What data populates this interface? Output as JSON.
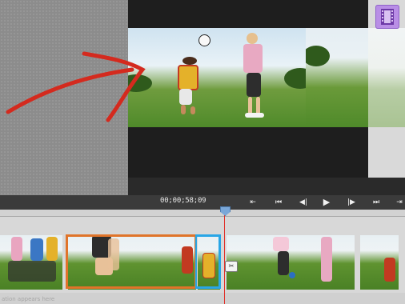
{
  "monitor": {
    "timecode": "00;00;58;09"
  },
  "transport": {
    "buttons": [
      {
        "name": "go-to-in-point",
        "glyph": "⇤"
      },
      {
        "name": "step-back-large",
        "glyph": "⏮"
      },
      {
        "name": "step-back-frame",
        "glyph": "◀|"
      },
      {
        "name": "play",
        "glyph": "▶"
      },
      {
        "name": "step-forward-frame",
        "glyph": "|▶"
      },
      {
        "name": "step-forward-large",
        "glyph": "⏭"
      },
      {
        "name": "go-to-out-point",
        "glyph": "⇥"
      }
    ]
  },
  "timeline": {
    "status_text": "ation appears here"
  },
  "colors": {
    "selection": "#e0742a",
    "trim": "#29a6e6",
    "playhead": "#e0302a",
    "annotation_arrow": "#d42a1e",
    "badge": "#b98ee6"
  },
  "icons": {
    "badge": "film-icon",
    "scissors": "scissors-icon"
  }
}
